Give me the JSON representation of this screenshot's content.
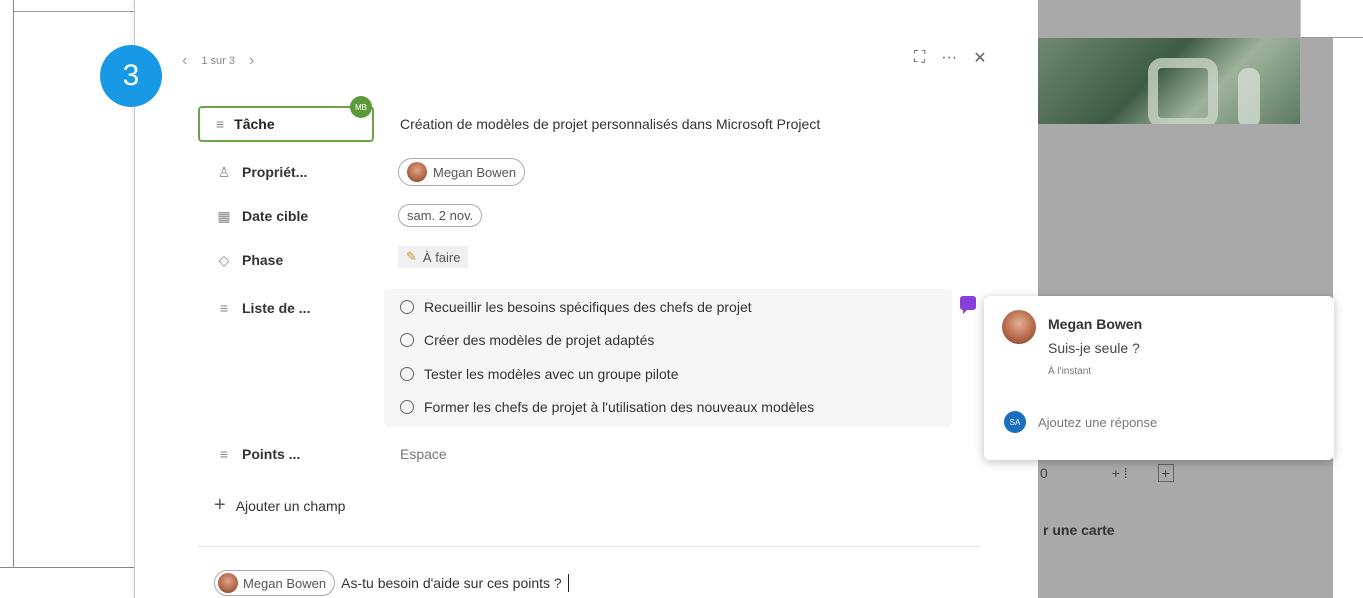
{
  "step_badge": "3",
  "nav": {
    "prev": "‹",
    "counter": "1 sur 3",
    "next": "›"
  },
  "top_actions": {
    "expand": "⛶",
    "more": "···",
    "close": "✕"
  },
  "avatar_initials": "MB",
  "fields": {
    "task": {
      "label": "Tâche",
      "value": "Création de modèles de projet personnalisés dans Microsoft Project"
    },
    "owner": {
      "label": "Propriét...",
      "value": "Megan Bowen"
    },
    "due": {
      "label": "Date cible",
      "value": "sam. 2 nov."
    },
    "phase": {
      "label": "Phase",
      "value": "À faire"
    },
    "checklist": {
      "label": "Liste de ...",
      "items": [
        "Recueillir les besoins spécifiques des chefs de projet",
        "Créer des modèles de projet adaptés",
        "Tester les modèles avec un groupe pilote",
        "Former les chefs de projet à l'utilisation des nouveaux modèles"
      ]
    },
    "points": {
      "label": "Points ...",
      "value": "Espace"
    }
  },
  "add_field": "Ajouter un champ",
  "composer": {
    "mention": "Megan Bowen",
    "text": "As-tu besoin d'aide sur ces points ?"
  },
  "comment_popup": {
    "author": "Megan Bowen",
    "message": "Suis-je seule ?",
    "time": "À l'instant",
    "reply_initials": "SA",
    "reply_placeholder": "Ajoutez une réponse"
  },
  "background": {
    "counter": "0",
    "add_card": "r une carte"
  },
  "colors": {
    "badge": "#1899e6",
    "task_border": "#6ba24a",
    "comment_icon": "#8a3fdc",
    "reply_avatar": "#1b6fc0"
  }
}
